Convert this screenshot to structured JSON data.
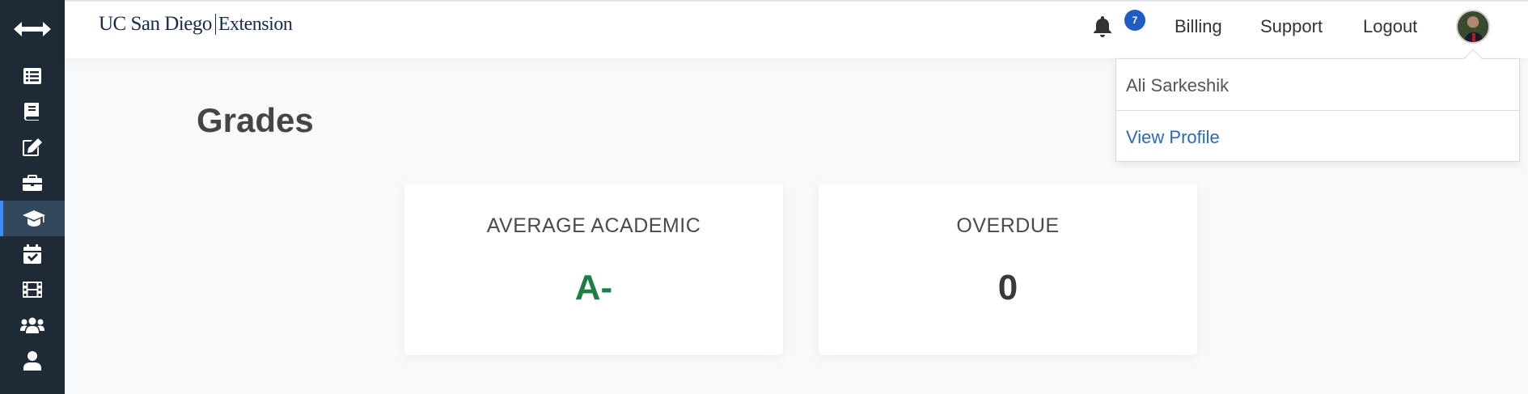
{
  "header": {
    "logo": {
      "part1": "UC San Diego",
      "part2": "Extension"
    },
    "notifications": {
      "count": "7"
    },
    "nav": {
      "billing": "Billing",
      "support": "Support",
      "logout": "Logout"
    }
  },
  "dropdown": {
    "user_name": "Ali Sarkeshik",
    "view_profile": "View Profile"
  },
  "main": {
    "title": "Grades",
    "cards": [
      {
        "label": "AVERAGE ACADEMIC",
        "value": "A-",
        "color": "#1e7e46"
      },
      {
        "label": "OVERDUE",
        "value": "0",
        "color": "#3a3a3a"
      }
    ]
  },
  "sidebar": {
    "items": [
      "list-icon",
      "book-icon",
      "edit-icon",
      "briefcase-icon",
      "graduation-cap-icon",
      "calendar-check-icon",
      "film-icon",
      "users-icon",
      "user-icon"
    ],
    "active": "graduation-cap-icon"
  },
  "colors": {
    "sidebar": "#1e2a36",
    "sidebar_active": "#34485c",
    "accent": "#3d8bfd",
    "link": "#2a68b8",
    "badge": "#1f5cc4",
    "grade": "#1e7e46"
  }
}
